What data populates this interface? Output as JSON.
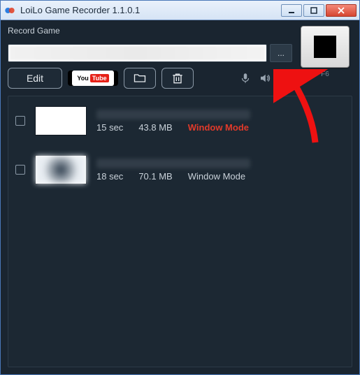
{
  "window": {
    "title": "LoiLo Game Recorder 1.1.0.1"
  },
  "section": {
    "record_label": "Record Game",
    "browse_label": "..."
  },
  "toolbar": {
    "edit_label": "Edit",
    "youtube_you": "You",
    "youtube_tube": "Tube"
  },
  "record_button": {
    "hotkey": "F6"
  },
  "recordings": [
    {
      "duration": "15 sec",
      "size": "43.8 MB",
      "mode": "Window Mode",
      "highlight": true
    },
    {
      "duration": "18 sec",
      "size": "70.1 MB",
      "mode": "Window Mode",
      "highlight": false
    }
  ]
}
